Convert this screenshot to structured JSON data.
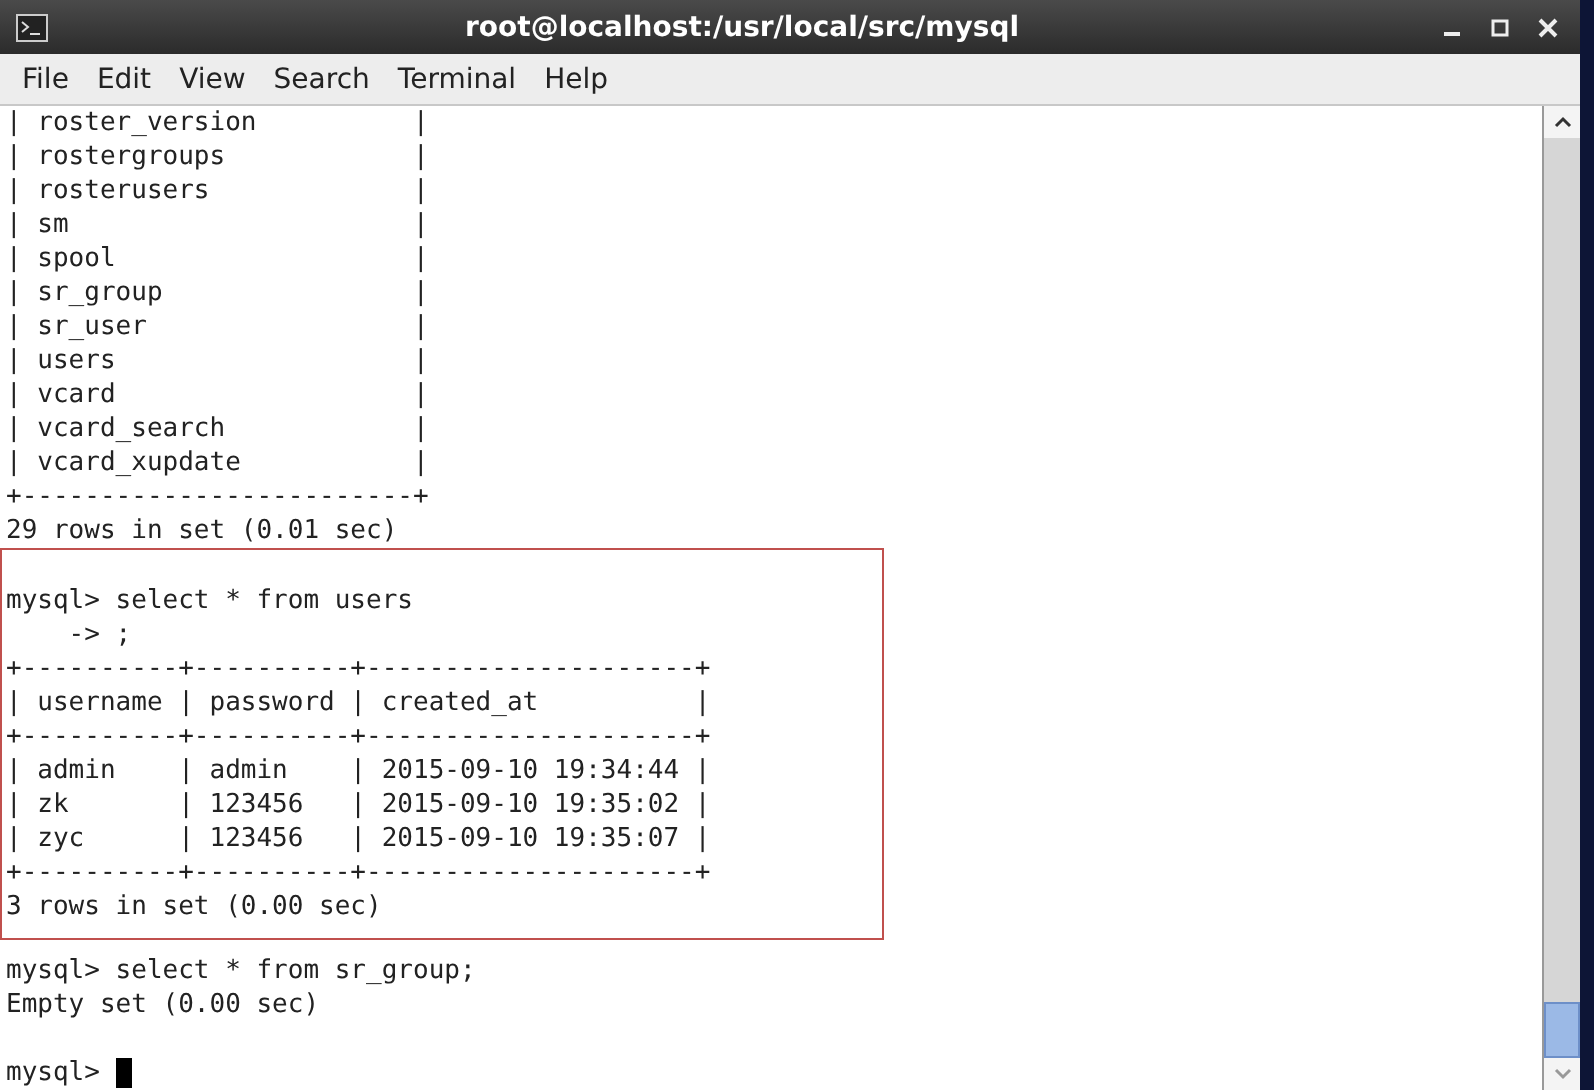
{
  "window": {
    "title": "root@localhost:/usr/local/src/mysql"
  },
  "menu": [
    "File",
    "Edit",
    "View",
    "Search",
    "Terminal",
    "Help"
  ],
  "terminal": {
    "blocks": [
      {
        "kind": "plain",
        "lines": [
          {
            "kind": "text",
            "text": "| roster_version          |"
          },
          {
            "kind": "text",
            "text": "| rostergroups            |"
          },
          {
            "kind": "text",
            "text": "| rosterusers             |"
          },
          {
            "kind": "text",
            "text": "| sm                      |"
          },
          {
            "kind": "text",
            "text": "| spool                   |"
          },
          {
            "kind": "text",
            "text": "| sr_group                |"
          },
          {
            "kind": "text",
            "text": "| sr_user                 |"
          },
          {
            "kind": "text",
            "text": "| users                   |"
          },
          {
            "kind": "text",
            "text": "| vcard                   |"
          },
          {
            "kind": "text",
            "text": "| vcard_search            |"
          },
          {
            "kind": "text",
            "text": "| vcard_xupdate           |"
          },
          {
            "kind": "text",
            "text": "+-------------------------+"
          },
          {
            "kind": "text",
            "text": "29 rows in set (0.01 sec)"
          }
        ]
      },
      {
        "kind": "highlight",
        "lines": [
          {
            "kind": "blank"
          },
          {
            "kind": "text",
            "text": "mysql> select * from users"
          },
          {
            "kind": "text",
            "text": "    -> ;"
          },
          {
            "kind": "text",
            "text": "+----------+----------+---------------------+"
          },
          {
            "kind": "text",
            "text": "| username | password | created_at          |"
          },
          {
            "kind": "text",
            "text": "+----------+----------+---------------------+"
          },
          {
            "kind": "text",
            "text": "| admin    | admin    | 2015-09-10 19:34:44 |"
          },
          {
            "kind": "text",
            "text": "| zk       | 123456   | 2015-09-10 19:35:02 |"
          },
          {
            "kind": "text",
            "text": "| zyc      | 123456   | 2015-09-10 19:35:07 |"
          },
          {
            "kind": "text",
            "text": "+----------+----------+---------------------+"
          },
          {
            "kind": "text",
            "text": "3 rows in set (0.00 sec)"
          }
        ]
      },
      {
        "kind": "plain",
        "lines": [
          {
            "kind": "text",
            "text": "mysql> select * from sr_group;"
          },
          {
            "kind": "text",
            "text": "Empty set (0.00 sec)"
          },
          {
            "kind": "blank"
          },
          {
            "kind": "prompt",
            "text": "mysql> "
          }
        ]
      }
    ]
  }
}
